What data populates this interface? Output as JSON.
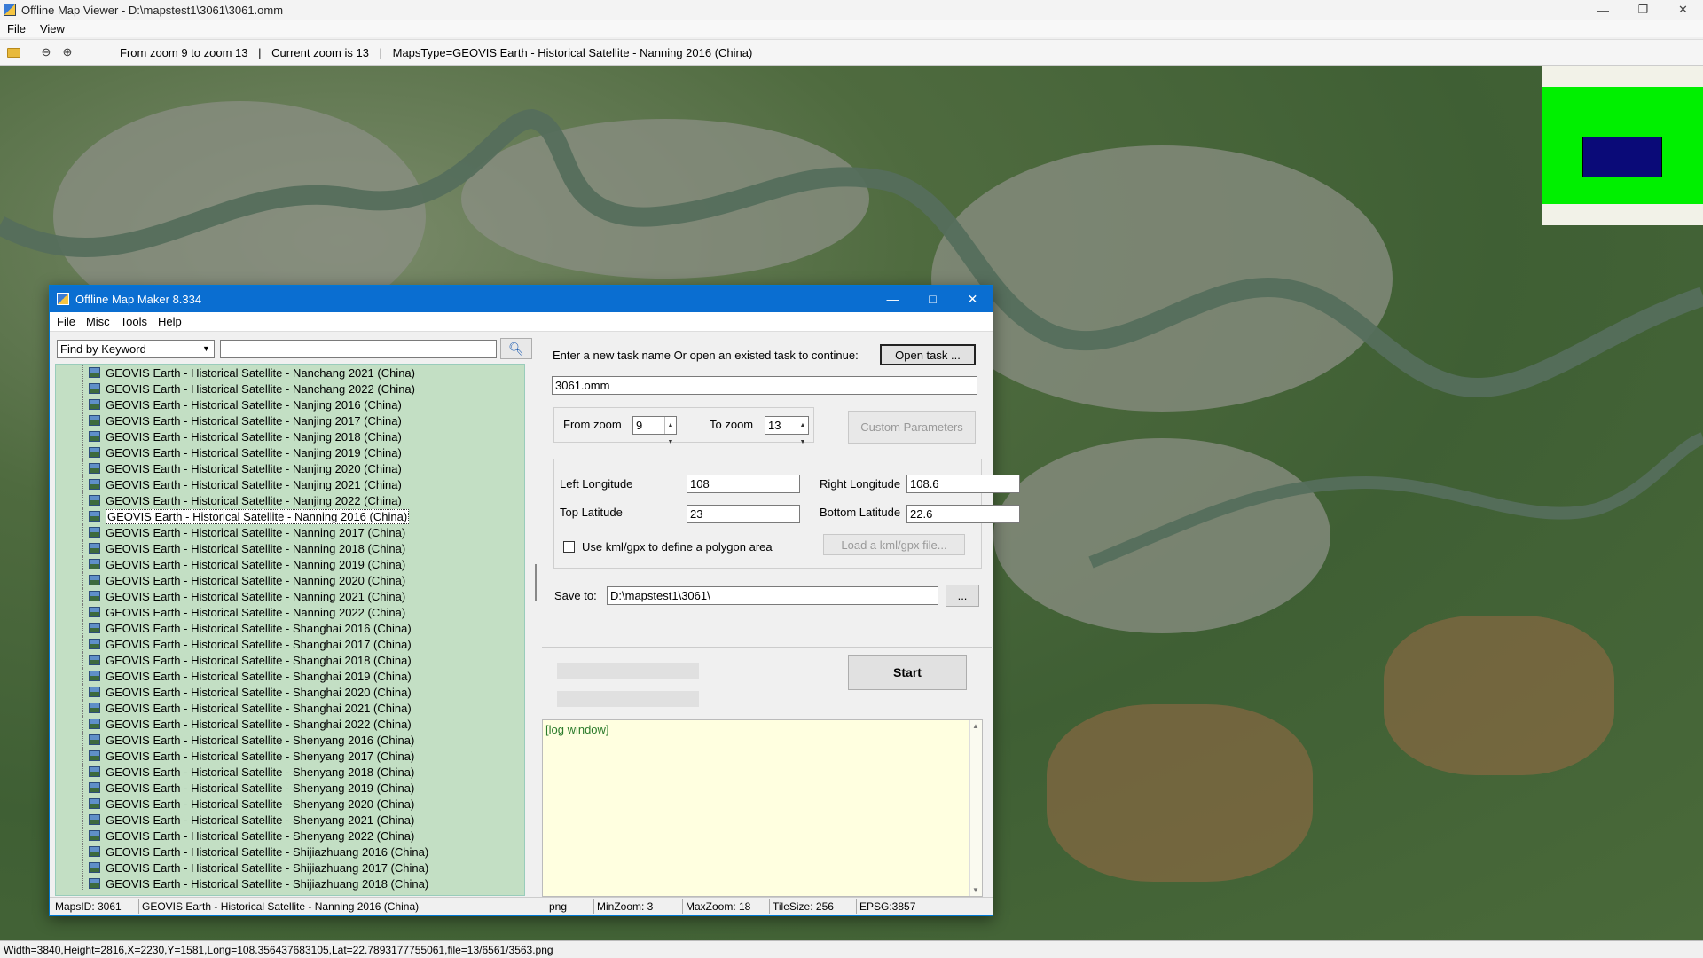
{
  "viewer": {
    "title": "Offline Map Viewer - D:\\mapstest1\\3061\\3061.omm",
    "menu": [
      "File",
      "View"
    ],
    "toolbar_info": {
      "zoom_range": "From zoom 9 to zoom 13",
      "current_zoom": "Current zoom is 13",
      "maps_type": "MapsType=GEOVIS Earth - Historical Satellite - Nanning 2016 (China)"
    },
    "status": "Width=3840,Height=2816,X=2230,Y=1581,Long=108.356437683105,Lat=22.7893177755061,file=13/6561/3563.png"
  },
  "dialog": {
    "title": "Offline Map Maker 8.334",
    "menu": [
      "File",
      "Misc",
      "Tools",
      "Help"
    ],
    "find_mode": "Find by Keyword",
    "search_value": "",
    "tree_items": [
      "GEOVIS Earth - Historical Satellite - Nanchang 2021 (China)",
      "GEOVIS Earth - Historical Satellite - Nanchang 2022 (China)",
      "GEOVIS Earth - Historical Satellite - Nanjing 2016 (China)",
      "GEOVIS Earth - Historical Satellite - Nanjing 2017 (China)",
      "GEOVIS Earth - Historical Satellite - Nanjing 2018 (China)",
      "GEOVIS Earth - Historical Satellite - Nanjing 2019 (China)",
      "GEOVIS Earth - Historical Satellite - Nanjing 2020 (China)",
      "GEOVIS Earth - Historical Satellite - Nanjing 2021 (China)",
      "GEOVIS Earth - Historical Satellite - Nanjing 2022 (China)",
      "GEOVIS Earth - Historical Satellite - Nanning 2016 (China)",
      "GEOVIS Earth - Historical Satellite - Nanning 2017 (China)",
      "GEOVIS Earth - Historical Satellite - Nanning 2018 (China)",
      "GEOVIS Earth - Historical Satellite - Nanning 2019 (China)",
      "GEOVIS Earth - Historical Satellite - Nanning 2020 (China)",
      "GEOVIS Earth - Historical Satellite - Nanning 2021 (China)",
      "GEOVIS Earth - Historical Satellite - Nanning 2022 (China)",
      "GEOVIS Earth - Historical Satellite - Shanghai 2016 (China)",
      "GEOVIS Earth - Historical Satellite - Shanghai 2017 (China)",
      "GEOVIS Earth - Historical Satellite - Shanghai 2018 (China)",
      "GEOVIS Earth - Historical Satellite - Shanghai 2019 (China)",
      "GEOVIS Earth - Historical Satellite - Shanghai 2020 (China)",
      "GEOVIS Earth - Historical Satellite - Shanghai 2021 (China)",
      "GEOVIS Earth - Historical Satellite - Shanghai 2022 (China)",
      "GEOVIS Earth - Historical Satellite - Shenyang 2016 (China)",
      "GEOVIS Earth - Historical Satellite - Shenyang 2017 (China)",
      "GEOVIS Earth - Historical Satellite - Shenyang 2018 (China)",
      "GEOVIS Earth - Historical Satellite - Shenyang 2019 (China)",
      "GEOVIS Earth - Historical Satellite - Shenyang 2020 (China)",
      "GEOVIS Earth - Historical Satellite - Shenyang 2021 (China)",
      "GEOVIS Earth - Historical Satellite - Shenyang 2022 (China)",
      "GEOVIS Earth - Historical Satellite - Shijiazhuang 2016 (China)",
      "GEOVIS Earth - Historical Satellite - Shijiazhuang 2017 (China)",
      "GEOVIS Earth - Historical Satellite - Shijiazhuang 2018 (China)"
    ],
    "selected_item": "GEOVIS Earth - Historical Satellite - Nanning 2016 (China)",
    "task_prompt": "Enter a new task name Or open an existed task to continue:",
    "open_task_label": "Open task ...",
    "task_name": "3061.omm",
    "from_zoom_label": "From zoom",
    "from_zoom": "9",
    "to_zoom_label": "To zoom",
    "to_zoom": "13",
    "custom_params_label": "Custom Parameters",
    "left_lon_label": "Left Longitude",
    "left_lon": "108",
    "right_lon_label": "Right Longitude",
    "right_lon": "108.6",
    "top_lat_label": "Top Latitude",
    "top_lat": "23",
    "bottom_lat_label": "Bottom Latitude",
    "bottom_lat": "22.6",
    "kml_label": "Use kml/gpx to define a polygon area",
    "load_kml_label": "Load a kml/gpx file...",
    "save_to_label": "Save to:",
    "save_to": "D:\\mapstest1\\3061\\",
    "browse_label": "...",
    "start_label": "Start",
    "log_text": "[log window]",
    "status": {
      "maps_id": "MapsID: 3061",
      "map_name": "GEOVIS Earth - Historical Satellite - Nanning 2016 (China)",
      "format": "png",
      "min_zoom": "MinZoom: 3",
      "max_zoom": "MaxZoom: 18",
      "tile_size": "TileSize: 256",
      "epsg": "EPSG:3857"
    }
  },
  "colors": {
    "tree_bg": "#c3dfc4",
    "dialog_title": "#0a6ed1",
    "log_bg": "#ffffe0",
    "overview_green": "#00f000",
    "overview_blue": "#0a0a78"
  }
}
